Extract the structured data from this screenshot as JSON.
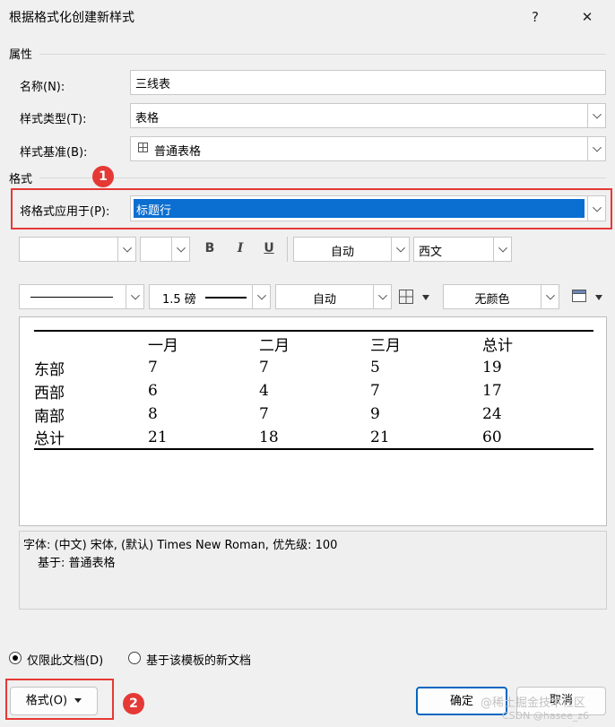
{
  "window": {
    "title": "根据格式化创建新样式",
    "help_label": "?",
    "close_label": "✕"
  },
  "properties": {
    "section_label": "属性",
    "name_label": "名称(N):",
    "name_value": "三线表",
    "type_label": "样式类型(T):",
    "type_value": "表格",
    "based_label": "样式基准(B):",
    "based_value": "普通表格"
  },
  "format": {
    "section_label": "格式",
    "apply_label": "将格式应用于(P):",
    "apply_value": "标题行",
    "font_name": "",
    "font_size": "",
    "bold_label": "B",
    "italic_label": "I",
    "underline_label": "U",
    "color_value": "自动",
    "script_value": "西文",
    "border_width": "1.5 磅",
    "border_color": "自动",
    "shading_value": "无颜色"
  },
  "annotations": {
    "badge1": "1",
    "badge2": "2"
  },
  "preview_table": {
    "headers": [
      "",
      "一月",
      "二月",
      "三月",
      "总计"
    ],
    "rows": [
      [
        "东部",
        "7",
        "7",
        "5",
        "19"
      ],
      [
        "西部",
        "6",
        "4",
        "7",
        "17"
      ],
      [
        "南部",
        "8",
        "7",
        "9",
        "24"
      ],
      [
        "总计",
        "21",
        "18",
        "21",
        "60"
      ]
    ]
  },
  "description": {
    "line1": "字体: (中文) 宋体, (默认) Times New Roman, 优先级: 100",
    "line2": "基于: 普通表格"
  },
  "scope": {
    "option1": "仅限此文档(D)",
    "option2": "基于该模板的新文档",
    "selected": "option1"
  },
  "buttons": {
    "format": "格式(O)",
    "ok": "确定",
    "cancel": "取消"
  },
  "watermark": {
    "line1": "@稀土掘金技术社区",
    "line2": "CSDN @hasee_z6"
  }
}
